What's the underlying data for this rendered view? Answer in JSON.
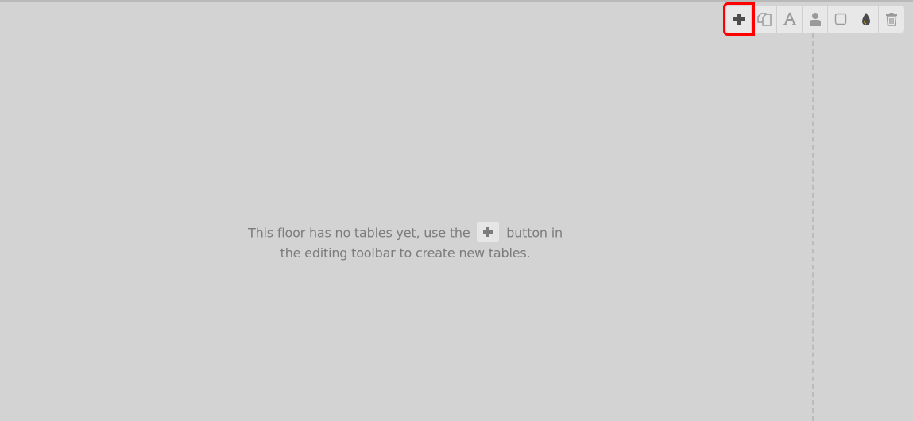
{
  "toolbar": {
    "buttons": [
      {
        "name": "add",
        "icon": "plus-icon"
      },
      {
        "name": "duplicate",
        "icon": "copy-icon"
      },
      {
        "name": "rename",
        "icon": "font-icon"
      },
      {
        "name": "seats",
        "icon": "user-icon"
      },
      {
        "name": "shape",
        "icon": "square-icon"
      },
      {
        "name": "color",
        "icon": "tint-icon"
      },
      {
        "name": "delete",
        "icon": "trash-icon"
      }
    ],
    "highlight_color": "#ff0000"
  },
  "empty_message": {
    "before": "This floor has no tables yet, use the",
    "after_line1": "button in",
    "line2": "the editing toolbar to create new tables.",
    "icon": "plus-icon"
  },
  "colors": {
    "background": "#d3d3d3",
    "toolbar": "#e8e8e8",
    "icon": "#555555",
    "text": "#7c7c7c"
  }
}
